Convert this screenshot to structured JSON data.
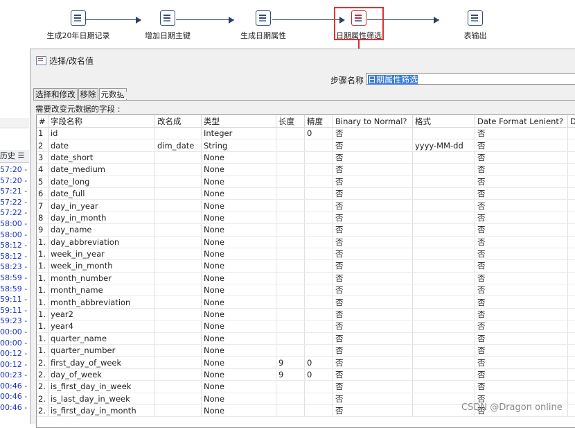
{
  "flow": {
    "steps": [
      {
        "label": "生成20年日期记录",
        "icon": "generate-rows-icon"
      },
      {
        "label": "增加日期主键",
        "icon": "add-sequence-icon"
      },
      {
        "label": "生成日期属性",
        "icon": "javascript-icon"
      },
      {
        "label": "日期属性筛选",
        "icon": "select-values-icon",
        "selected": true
      },
      {
        "label": "表输出",
        "icon": "table-output-icon"
      }
    ],
    "highlight_color": "#e03030"
  },
  "left_panel": {
    "tab_label": "历史",
    "log_lines": [
      "57:20 - ",
      "57:20 - ",
      "57:21 - ",
      "57:22 - ",
      "57:22 - ",
      "58:00 - ",
      "58:00 - ",
      "58:12 - ",
      "58:12 - ",
      "58:23 - ",
      "58:59 - ",
      "58:59 - ",
      "59:11 - ",
      "59:11 - ",
      "59:23 - ",
      "00:00 - ",
      "00:00 - ",
      "00:12 - ",
      "00:12 - ",
      "00:23 - ",
      "00:46 - ",
      "00:46 - ",
      "00:46 - "
    ]
  },
  "dialog": {
    "title": "选择/改名值",
    "step_name_label": "步骤名称",
    "step_name_value": "日期属性筛选",
    "tabs": [
      "选择和修改",
      "移除",
      "元数据"
    ],
    "active_tab": 2,
    "fields_label": "需要改变元数据的字段 :",
    "columns": [
      "#",
      "字段名称",
      "改名成",
      "类型",
      "长度",
      "精度",
      "Binary to Normal?",
      "格式",
      "Date Format Lenient?",
      "D"
    ],
    "rows": [
      [
        "1",
        "id",
        "",
        "Integer",
        "",
        "0",
        "否",
        "",
        "否"
      ],
      [
        "2",
        "date",
        "dim_date",
        "String",
        "",
        "",
        "否",
        "yyyy-MM-dd",
        "否"
      ],
      [
        "3",
        "date_short",
        "",
        "None",
        "",
        "",
        "否",
        "",
        "否"
      ],
      [
        "4",
        "date_medium",
        "",
        "None",
        "",
        "",
        "否",
        "",
        "否"
      ],
      [
        "5",
        "date_long",
        "",
        "None",
        "",
        "",
        "否",
        "",
        "否"
      ],
      [
        "6",
        "date_full",
        "",
        "None",
        "",
        "",
        "否",
        "",
        "否"
      ],
      [
        "7",
        "day_in_year",
        "",
        "None",
        "",
        "",
        "否",
        "",
        "否"
      ],
      [
        "8",
        "day_in_month",
        "",
        "None",
        "",
        "",
        "否",
        "",
        "否"
      ],
      [
        "9",
        "day_name",
        "",
        "None",
        "",
        "",
        "否",
        "",
        "否"
      ],
      [
        "1.",
        "day_abbreviation",
        "",
        "None",
        "",
        "",
        "否",
        "",
        "否"
      ],
      [
        "1.",
        "week_in_year",
        "",
        "None",
        "",
        "",
        "否",
        "",
        "否"
      ],
      [
        "1.",
        "week_in_month",
        "",
        "None",
        "",
        "",
        "否",
        "",
        "否"
      ],
      [
        "1.",
        "month_number",
        "",
        "None",
        "",
        "",
        "否",
        "",
        "否"
      ],
      [
        "1.",
        "month_name",
        "",
        "None",
        "",
        "",
        "否",
        "",
        "否"
      ],
      [
        "1.",
        "month_abbreviation",
        "",
        "None",
        "",
        "",
        "否",
        "",
        "否"
      ],
      [
        "1.",
        "year2",
        "",
        "None",
        "",
        "",
        "否",
        "",
        "否"
      ],
      [
        "1.",
        "year4",
        "",
        "None",
        "",
        "",
        "否",
        "",
        "否"
      ],
      [
        "1.",
        "quarter_name",
        "",
        "None",
        "",
        "",
        "否",
        "",
        "否"
      ],
      [
        "1.",
        "quarter_number",
        "",
        "None",
        "",
        "",
        "否",
        "",
        "否"
      ],
      [
        "2.",
        "first_day_of_week",
        "",
        "None",
        "9",
        "0",
        "否",
        "",
        "否"
      ],
      [
        "2.",
        "day_of_week",
        "",
        "None",
        "9",
        "0",
        "否",
        "",
        "否"
      ],
      [
        "2.",
        "is_first_day_in_week",
        "",
        "None",
        "",
        "",
        "否",
        "",
        "否"
      ],
      [
        "2.",
        "is_last_day_in_week",
        "",
        "None",
        "",
        "",
        "否",
        "",
        "否"
      ],
      [
        "2.",
        "is_first_day_in_month",
        "",
        "None",
        "",
        "",
        "否",
        "",
        "否"
      ]
    ]
  },
  "watermark": "CSDN @Dragon online"
}
